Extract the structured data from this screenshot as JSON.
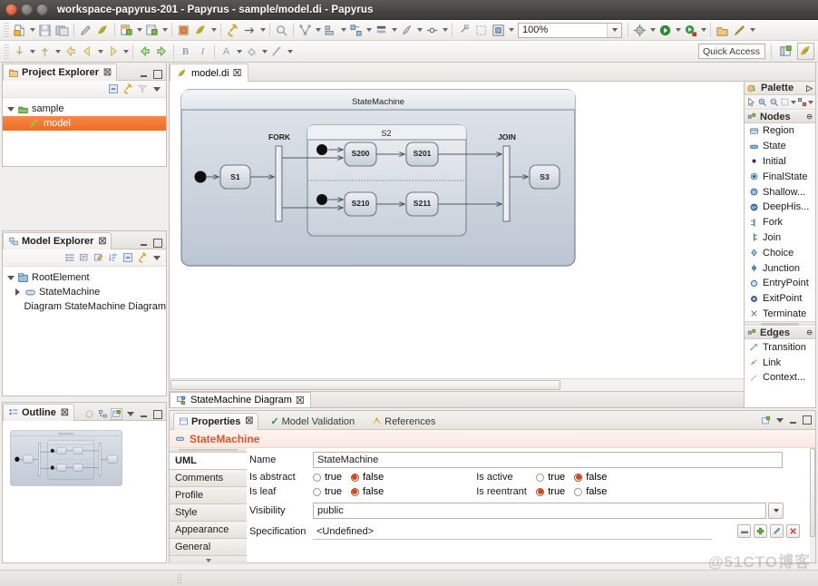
{
  "window": {
    "title": "workspace-papyrus-201 - Papyrus - sample/model.di - Papyrus",
    "close_icon": "close-icon",
    "minimize_icon": "minimize-icon",
    "maximize_icon": "maximize-icon"
  },
  "toolbar": {
    "zoom_value": "100%",
    "quick_access_placeholder": "Quick Access",
    "row1_icons": [
      "new-icon",
      "new-dropdown",
      "save-icon",
      "save-all-icon",
      "pencil-icon",
      "papyrus-icon",
      "new-model-icon",
      "new-model-dropdown",
      "new-diagram-icon",
      "new-diagram-dropdown",
      "import-icon",
      "papyrus-perspective-icon",
      "papyrus-dropdown",
      "link-icon",
      "arrow-right-icon",
      "arrow-dropdown",
      "search-icon",
      "layout-icon",
      "layout-dropdown",
      "align-icon",
      "align-dropdown",
      "distribute-icon",
      "distribute-dropdown",
      "fill-icon",
      "fill-dropdown",
      "style-icon",
      "style-dropdown",
      "route-icon",
      "route-dropdown",
      "resize-icon",
      "snap-icon",
      "grid-icon",
      "grid-dropdown",
      "diagram-icon",
      "diagram-dropdown"
    ],
    "row2_icons": [
      "debug-icon",
      "debug-dropdown",
      "run-icon",
      "run-dropdown",
      "external-tools-icon",
      "external-tools-dropdown",
      "open-type-icon",
      "search-decl-icon",
      "search-dropdown"
    ],
    "row3_icons": [
      "down-arrow-icon",
      "down-dropdown",
      "up-arrow-icon",
      "up-dropdown",
      "back-icon",
      "prev-icon",
      "prev-dropdown",
      "next-icon",
      "next-dropdown",
      "left-green-icon",
      "right-green-icon",
      "bold-icon",
      "italic-icon",
      "font-color-icon",
      "font-color-dropdown",
      "fill-color-icon",
      "fill-color-dropdown",
      "line-color-icon",
      "line-color-dropdown"
    ],
    "quick_right_icons": [
      "open-perspective-icon",
      "papyrus-perspective-icon"
    ]
  },
  "project_explorer": {
    "tab_label": "Project Explorer",
    "close_glyph": "☒",
    "toolbar_icons": [
      "collapse-all-icon",
      "link-editor-icon",
      "filter-icon",
      "view-menu-icon"
    ],
    "tree": [
      {
        "label": "sample",
        "icon": "project-folder-icon",
        "depth": 0,
        "twisty": "open",
        "selected": false
      },
      {
        "label": "model",
        "icon": "papyrus-model-icon",
        "depth": 1,
        "twisty": "none",
        "selected": true
      }
    ]
  },
  "model_explorer": {
    "tab_label": "Model Explorer",
    "close_glyph": "☒",
    "toolbar_icons": [
      "list-icon",
      "tree-filter-icon",
      "edit-icon",
      "sort-icon",
      "collapse-all-icon",
      "link-icon",
      "view-menu-icon"
    ],
    "tree": [
      {
        "label": "RootElement",
        "icon": "model-root-icon",
        "depth": 0,
        "twisty": "open",
        "selected": false
      },
      {
        "label": "StateMachine",
        "icon": "statemachine-icon",
        "depth": 1,
        "twisty": "closed",
        "selected": false
      },
      {
        "label": "Diagram StateMachine Diagram",
        "icon": "diagram-icon",
        "depth": 1,
        "twisty": "none",
        "selected": false
      }
    ]
  },
  "outline": {
    "tab_label": "Outline",
    "close_glyph": "☒",
    "toolbar_icons": [
      "sync-icon",
      "hierarchy-icon",
      "overview-icon",
      "view-menu-icon"
    ]
  },
  "editor": {
    "tab_label": "model.di",
    "tab_icon": "papyrus-model-icon",
    "close_glyph": "☒",
    "bottom_tab_label": "StateMachine Diagram",
    "bottom_tab_icon": "statemachine-diagram-icon"
  },
  "palette": {
    "title": "Palette",
    "pin_glyph": "▷",
    "tools": [
      "select-tool-icon",
      "zoom-in-icon",
      "zoom-out-icon",
      "marquee-icon",
      "marquee-dropdown",
      "format-icon",
      "format-dropdown"
    ],
    "groups": [
      {
        "name": "Nodes",
        "collapse_glyph": "⊖",
        "items": [
          {
            "label": "Region",
            "icon": "region-icon"
          },
          {
            "label": "State",
            "icon": "state-icon"
          },
          {
            "label": "Initial",
            "icon": "initial-icon"
          },
          {
            "label": "FinalState",
            "icon": "finalstate-icon"
          },
          {
            "label": "Shallow...",
            "icon": "shallow-history-icon"
          },
          {
            "label": "DeepHis...",
            "icon": "deep-history-icon"
          },
          {
            "label": "Fork",
            "icon": "fork-icon"
          },
          {
            "label": "Join",
            "icon": "join-icon"
          },
          {
            "label": "Choice",
            "icon": "choice-icon"
          },
          {
            "label": "Junction",
            "icon": "junction-icon"
          },
          {
            "label": "EntryPoint",
            "icon": "entrypoint-icon"
          },
          {
            "label": "ExitPoint",
            "icon": "exitpoint-icon"
          },
          {
            "label": "Terminate",
            "icon": "terminate-icon"
          }
        ]
      },
      {
        "name": "Edges",
        "collapse_glyph": "⊖",
        "items": [
          {
            "label": "Transition",
            "icon": "transition-icon"
          },
          {
            "label": "Link",
            "icon": "link-icon"
          },
          {
            "label": "Context...",
            "icon": "context-link-icon"
          }
        ]
      }
    ]
  },
  "properties": {
    "tabs": [
      {
        "label": "Properties",
        "icon": "properties-icon",
        "active": true,
        "close_glyph": "☒"
      },
      {
        "label": "Model Validation",
        "icon": "validation-check-icon",
        "active": false,
        "close_glyph": ""
      },
      {
        "label": "References",
        "icon": "references-icon",
        "active": false,
        "close_glyph": ""
      }
    ],
    "header_icons": [
      "pin-view-icon",
      "view-menu-icon",
      "minimize-icon",
      "maximize-icon"
    ],
    "element_title": "StateMachine",
    "element_icon": "statemachine-icon",
    "side_tabs": [
      {
        "label": "UML",
        "selected": true
      },
      {
        "label": "Comments",
        "selected": false
      },
      {
        "label": "Profile",
        "selected": false
      },
      {
        "label": "Style",
        "selected": false
      },
      {
        "label": "Appearance",
        "selected": false
      },
      {
        "label": "General",
        "selected": false
      }
    ],
    "fields": {
      "name_label": "Name",
      "name_value": "StateMachine",
      "is_abstract_label": "Is abstract",
      "is_abstract_value": "false",
      "is_leaf_label": "Is leaf",
      "is_leaf_value": "false",
      "is_active_label": "Is active",
      "is_active_value": "false",
      "is_reentrant_label": "Is reentrant",
      "is_reentrant_value": "true",
      "true_label": "true",
      "false_label": "false",
      "visibility_label": "Visibility",
      "visibility_value": "public",
      "specification_label": "Specification",
      "specification_value": "<Undefined>"
    },
    "spec_buttons": [
      "browse-icon",
      "add-icon",
      "edit-icon",
      "delete-icon"
    ]
  },
  "diagram": {
    "frame_title": "StateMachine",
    "composite_title": "S2",
    "fork_label": "FORK",
    "join_label": "JOIN",
    "states": [
      {
        "id": "S1",
        "label": "S1"
      },
      {
        "id": "S200",
        "label": "S200"
      },
      {
        "id": "S201",
        "label": "S201"
      },
      {
        "id": "S210",
        "label": "S210"
      },
      {
        "id": "S211",
        "label": "S211"
      },
      {
        "id": "S3",
        "label": "S3"
      }
    ],
    "initial_nodes": 3,
    "colors": {
      "frame_fill_top": "#d3d8e0",
      "frame_fill_bottom": "#c3ccd7",
      "state_fill_top": "#e9ecef",
      "state_fill_bottom": "#c9d0d8",
      "border": "#6a7581",
      "text": "#1b1b1b"
    }
  },
  "statusbar": {
    "watermark": "@51CTO博客"
  }
}
